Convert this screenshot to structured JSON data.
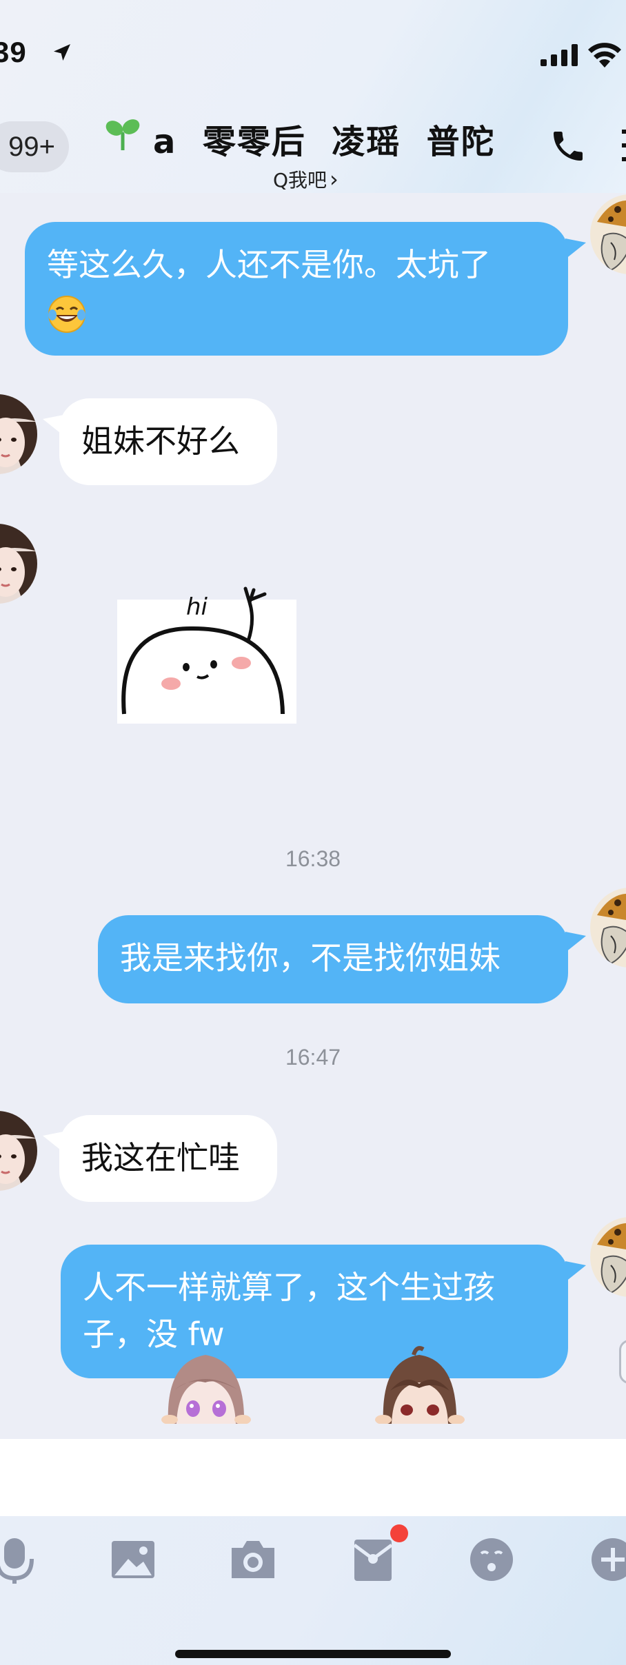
{
  "status_bar": {
    "time": "39"
  },
  "nav": {
    "back_badge": "99+",
    "title": "a  零零后  凌瑶  普陀",
    "subtitle": "Q我吧",
    "subtitle_chevron": "›"
  },
  "messages": [
    {
      "side": "out",
      "text_line1": "等这么久，人还不是你。太坑了",
      "emoji": "laughing-tears"
    },
    {
      "side": "in",
      "text": "姐妹不好么"
    },
    {
      "side": "in",
      "sticker": "hi-blob-sticker",
      "sticker_text": "hi"
    },
    {
      "type": "time",
      "text": "16:38"
    },
    {
      "side": "out",
      "text": "我是来找你，不是找你姐妹"
    },
    {
      "type": "time",
      "text": "16:47"
    },
    {
      "side": "in",
      "text": "我这在忙哇"
    },
    {
      "side": "out",
      "text_line1": "人不一样就算了，这个生过孩",
      "text_line2": "子，没 fw"
    }
  ],
  "toolbar": {
    "icons": [
      "microphone-icon",
      "image-icon",
      "camera-icon",
      "red-packet-icon",
      "emoji-icon",
      "plus-icon"
    ]
  },
  "colors": {
    "outgoing_bubble": "#53b4f6",
    "incoming_bubble": "#ffffff",
    "background": "#eceef6",
    "badge_red": "#f4423a"
  }
}
